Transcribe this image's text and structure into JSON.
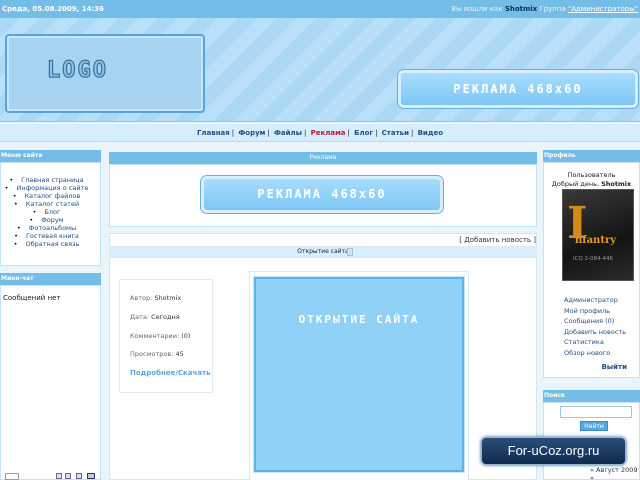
{
  "topbar": {
    "date": "Среда, 05.08.2009, 14:36",
    "user_prefix": "Вы вошли как",
    "user": "Shotmix",
    "group_label": "Группа",
    "group": "\"Администраторы\""
  },
  "header": {
    "logo": "LOGO",
    "banner": "РЕКЛАМА 468x60"
  },
  "nav": [
    "Главная",
    "Форум",
    "Файлы",
    "Реклама",
    "Блог",
    "Статьи",
    "Видео"
  ],
  "left": {
    "menu_title": "Меню сайта",
    "menu": [
      "Главная страница",
      "Информация о сайте",
      "Каталог файлов",
      "Каталог статей",
      "Блог",
      "Форум",
      "Фотоальбомы",
      "Гостевая книга",
      "Обратная связь"
    ],
    "chat_title": "Мини-чат",
    "chat_empty": "Сообщений нет"
  },
  "center": {
    "ad_title": "Реклама",
    "ad_banner": "РЕКЛАМА 468x60",
    "add_news": "[ Добавить новость ]",
    "news_title": "Открытие сайта",
    "meta": {
      "author_label": "Автор:",
      "author": "Shotmix",
      "date_label": "Дата:",
      "date": "Сегодня",
      "comments_label": "Комментарии:",
      "comments": "(0)",
      "views_label": "Просмотров:",
      "views": "45",
      "more": "Подробнее/Скачать"
    },
    "image_text": "ОТКРЫТИЕ САЙТА"
  },
  "right": {
    "profile_title": "Профиль",
    "user_label": "Пользователь",
    "greeting_prefix": "Добрый день,",
    "greeting_user": "Shotmix",
    "avatar_big": "I",
    "avatar_word": "nfantry",
    "avatar_sub": "ICQ 2-084-446",
    "links": [
      "Администратор",
      "Мой профиль",
      "Сообщения (0)",
      "Добавить новость",
      "Статистика",
      "Обзор нового"
    ],
    "logout": "Выйти",
    "search_title": "Поиск",
    "search_button": "Найти",
    "calendar": "« Август 2009 »"
  },
  "watermark": "For-uCoz.org.ru"
}
